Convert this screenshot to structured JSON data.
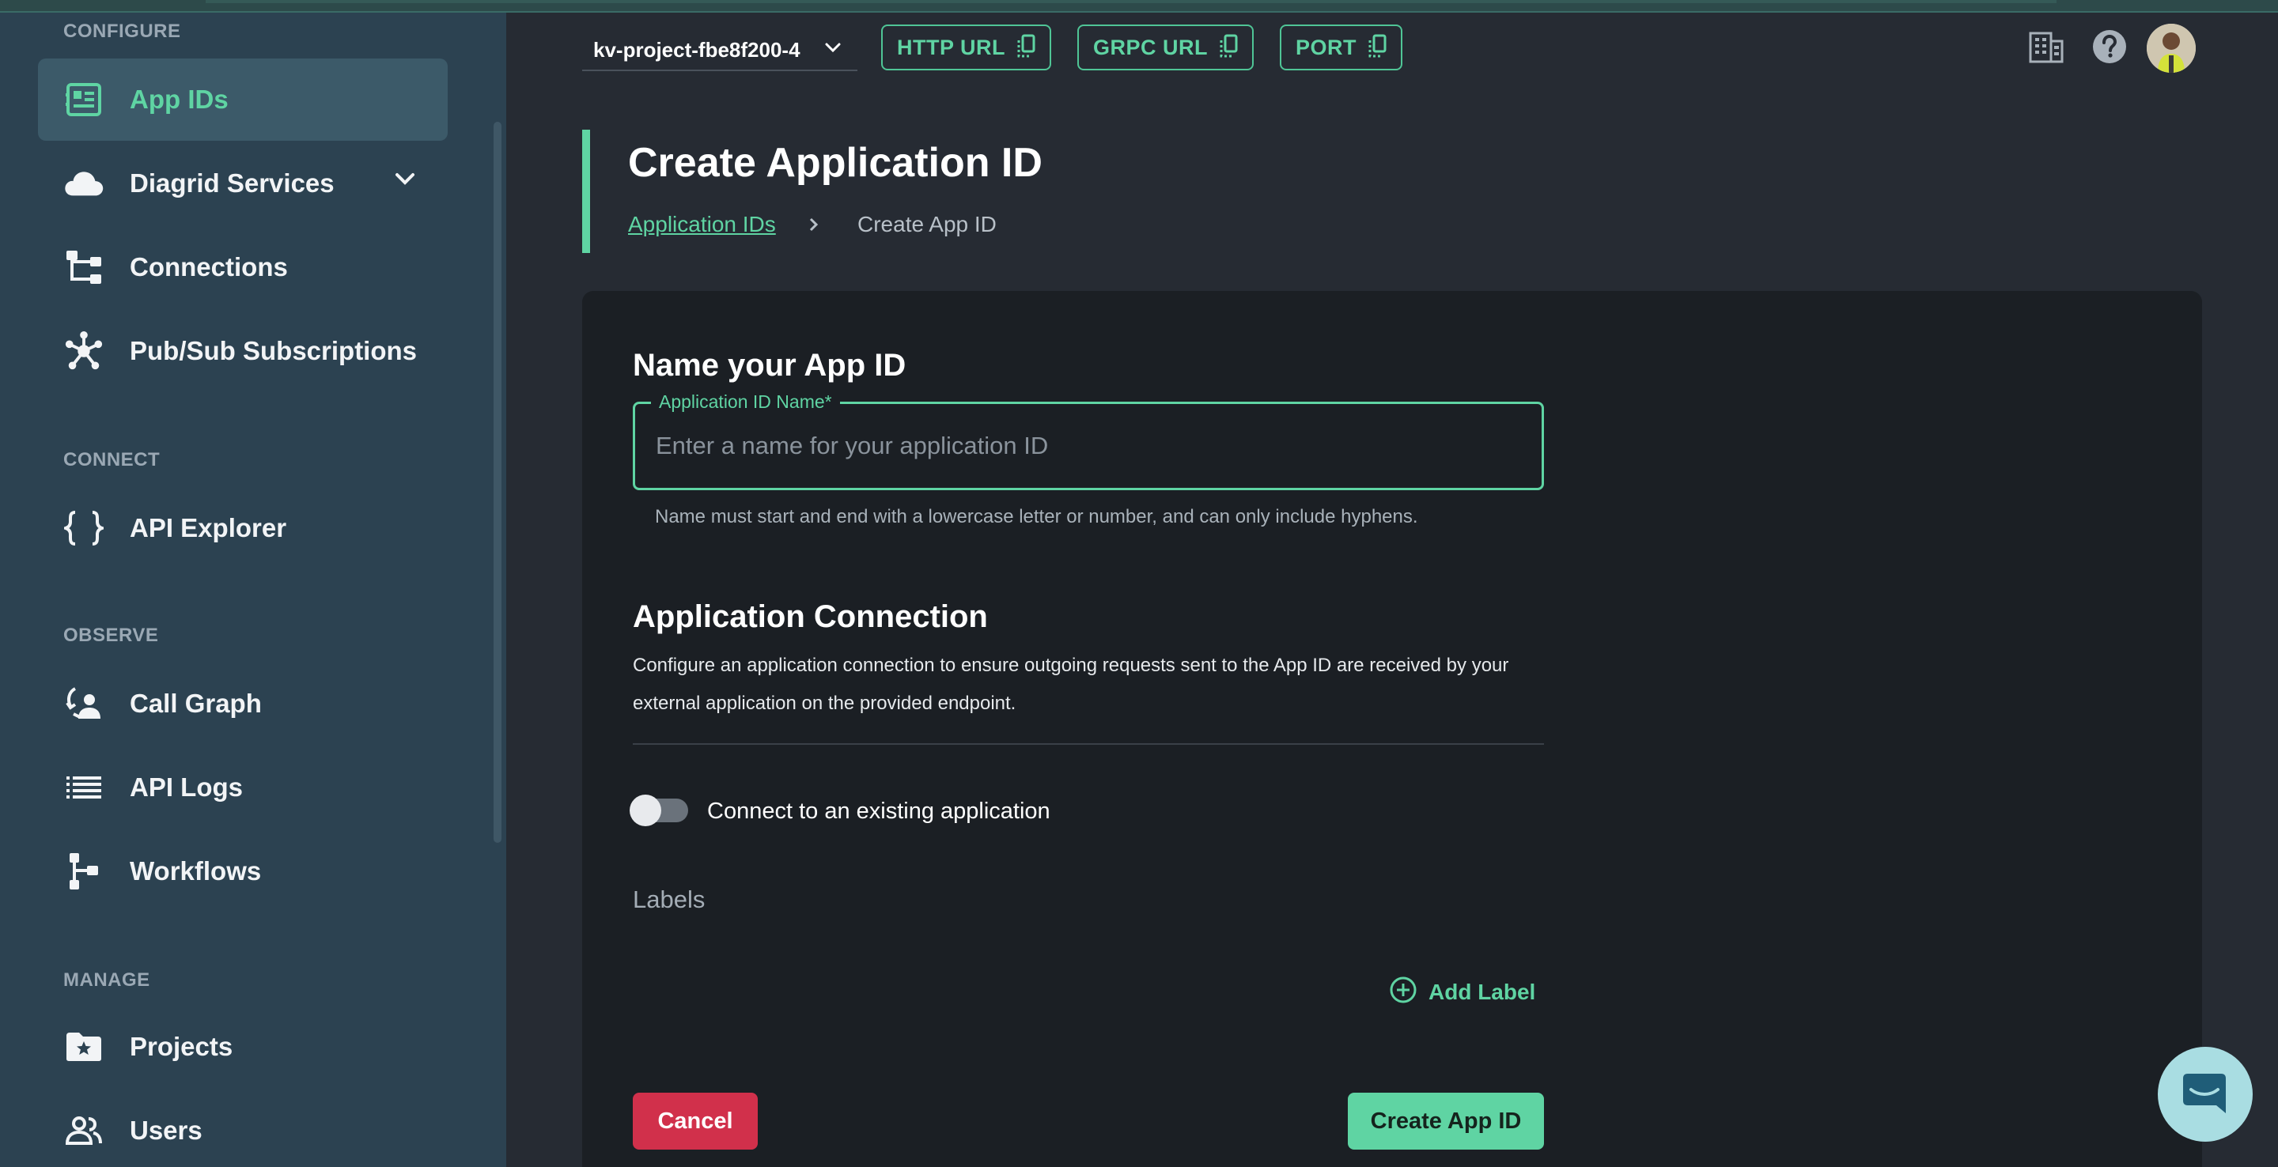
{
  "colors": {
    "accent": "#5fd4a3",
    "sidebar_bg": "#2c4251",
    "card_bg": "#1b1f24",
    "danger": "#d1304b"
  },
  "sidebar": {
    "sections": {
      "configure": "CONFIGURE",
      "connect": "CONNECT",
      "observe": "OBSERVE",
      "manage": "MANAGE"
    },
    "items": [
      {
        "label": "App IDs",
        "icon": "app-ids-icon",
        "active": true
      },
      {
        "label": "Diagrid Services",
        "icon": "cloud-icon"
      },
      {
        "label": "Connections",
        "icon": "connections-icon"
      },
      {
        "label": "Pub/Sub Subscriptions",
        "icon": "pubsub-icon"
      },
      {
        "label": "API Explorer",
        "icon": "braces-icon"
      },
      {
        "label": "Call Graph",
        "icon": "call-graph-icon"
      },
      {
        "label": "API Logs",
        "icon": "list-icon"
      },
      {
        "label": "Workflows",
        "icon": "workflow-icon"
      },
      {
        "label": "Projects",
        "icon": "folder-star-icon"
      },
      {
        "label": "Users",
        "icon": "users-icon"
      }
    ]
  },
  "header": {
    "project": "kv-project-fbe8f200-4",
    "http_url": "HTTP URL",
    "grpc_url": "GRPC URL",
    "port": "PORT"
  },
  "page": {
    "title": "Create Application ID",
    "breadcrumb_link": "Application IDs",
    "breadcrumb_current": "Create App ID"
  },
  "form": {
    "name_heading": "Name your App ID",
    "name_legend": "Application ID Name",
    "name_required": "*",
    "name_placeholder": "Enter a name for your application ID",
    "name_value": "",
    "name_helper": "Name must start and end with a lowercase letter or number, and can only include hyphens.",
    "connection_heading": "Application Connection",
    "connection_desc": "Configure an application connection to ensure outgoing requests sent to the App ID are received by your external application on the provided endpoint.",
    "toggle_label": "Connect to an existing application",
    "toggle_on": false,
    "labels_title": "Labels",
    "add_label": "Add Label",
    "cancel": "Cancel",
    "create": "Create App ID"
  }
}
